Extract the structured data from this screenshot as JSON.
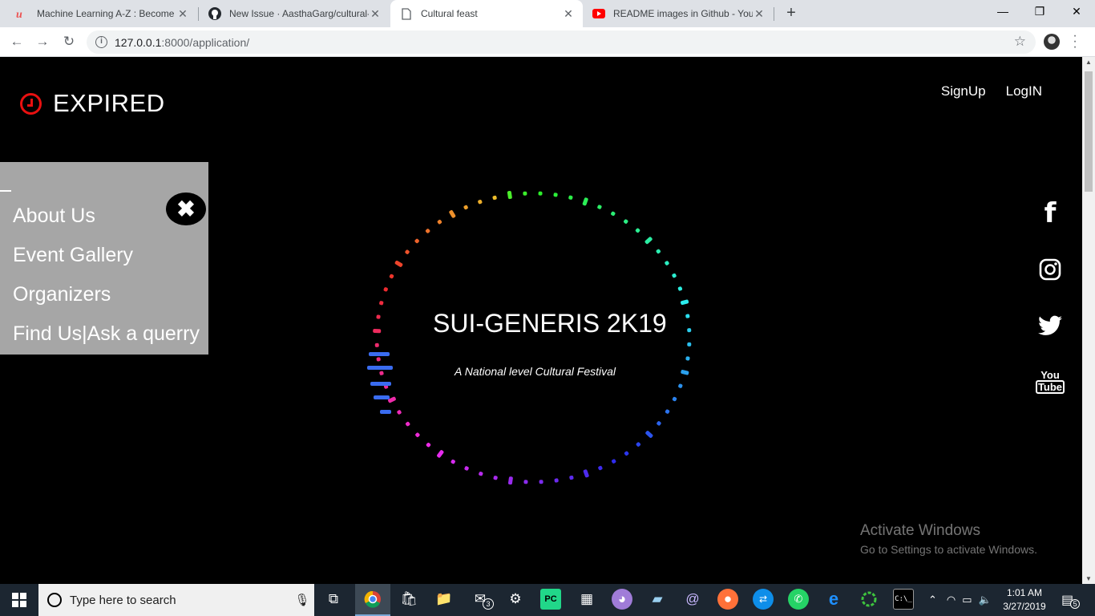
{
  "browser": {
    "tabs": [
      {
        "title": "Machine Learning A-Z : Become",
        "icon": "udemy-icon",
        "active": false
      },
      {
        "title": "New Issue · AasthaGarg/cultural-",
        "icon": "github-icon",
        "active": false
      },
      {
        "title": "Cultural feast",
        "icon": "page-icon",
        "active": true
      },
      {
        "title": "README images in Github - YouT",
        "icon": "youtube-icon",
        "active": false
      }
    ],
    "url_host": "127.0.0.1",
    "url_path": ":8000/application/"
  },
  "site": {
    "brand": "EXPIRED",
    "auth": {
      "signup": "SignUp",
      "login": "LogIN"
    },
    "sidenav": {
      "items": [
        "About Us",
        "Event Gallery",
        "Organizers",
        "Find Us|Ask a querry"
      ],
      "close_icon": "close-icon"
    },
    "hero": {
      "title": "SUI-GENERIS 2K19",
      "subtitle": "A National level Cultural Festival"
    },
    "social": [
      "facebook-icon",
      "instagram-icon",
      "twitter-icon",
      "youtube-icon"
    ],
    "youtube_text": {
      "you": "You",
      "tube": "Tube"
    }
  },
  "watermark": {
    "line1": "Activate Windows",
    "line2": "Go to Settings to activate Windows."
  },
  "taskbar": {
    "search_placeholder": "Type here to search",
    "mail_badge": "3",
    "time": "1:01 AM",
    "date": "3/27/2019",
    "notification_count": "5"
  },
  "colors": {
    "brand_clock": "#e81010",
    "sidenav_bg": "#a6a6a6",
    "page_bg": "#000000"
  }
}
